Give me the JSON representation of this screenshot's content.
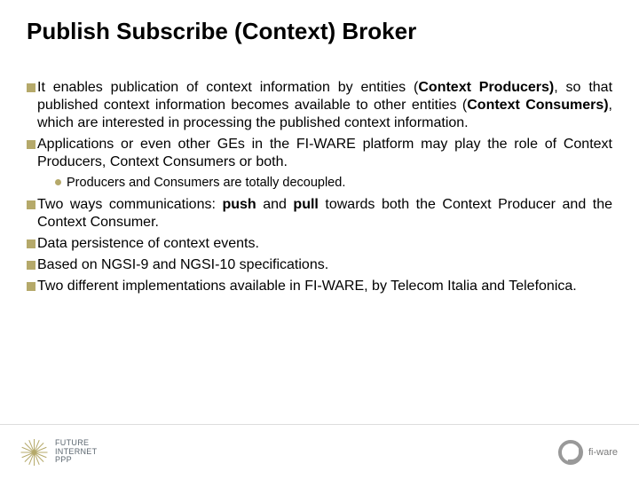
{
  "title": "Publish Subscribe (Context) Broker",
  "bullets": {
    "b1a": "It enables publication of context information by entities (",
    "b1b": "Context Producers)",
    "b1c": ", so that published context information becomes available to other entities (",
    "b1d": "Context Consumers)",
    "b1e": ", which are interested in processing the published context information.",
    "b2": "Applications or even other GEs in the FI-WARE platform may play the role of Context Producers, Context Consumers or both.",
    "sub1": "Producers and Consumers are totally decoupled.",
    "b3a": "Two ways communications: ",
    "b3b": "push",
    "b3c": " and ",
    "b3d": "pull",
    "b3e": " towards both the Context Producer and the Context Consumer.",
    "b4": "Data persistence of context events.",
    "b5": "Based on NGSI-9 and NGSI-10 specifications.",
    "b6": "Two different implementations available in FI-WARE, by Telecom Italia and Telefonica."
  },
  "footer": {
    "left1": "FUTURE",
    "left2": "INTERNET",
    "left3": "PPP",
    "right": "fi-ware"
  }
}
